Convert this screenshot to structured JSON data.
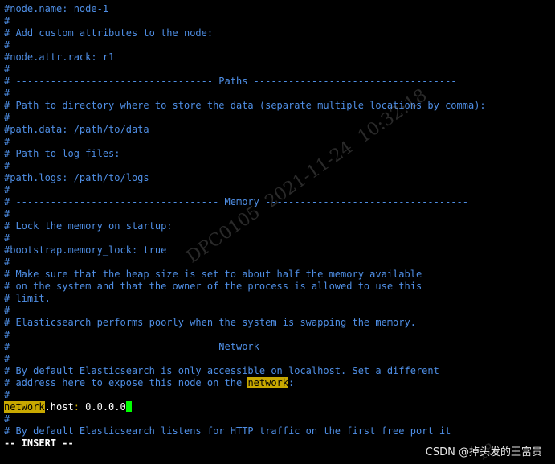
{
  "editor": {
    "lines": [
      {
        "type": "comment",
        "text": "#node.name: node-1"
      },
      {
        "type": "comment",
        "text": "#"
      },
      {
        "type": "comment",
        "text": "# Add custom attributes to the node:"
      },
      {
        "type": "comment",
        "text": "#"
      },
      {
        "type": "comment",
        "text": "#node.attr.rack: r1"
      },
      {
        "type": "comment",
        "text": "#"
      },
      {
        "type": "comment",
        "text": "# ---------------------------------- Paths -----------------------------------"
      },
      {
        "type": "comment",
        "text": "#"
      },
      {
        "type": "comment",
        "text": "# Path to directory where to store the data (separate multiple locations by comma):"
      },
      {
        "type": "comment",
        "text": "#"
      },
      {
        "type": "comment",
        "text": "#path.data: /path/to/data"
      },
      {
        "type": "comment",
        "text": "#"
      },
      {
        "type": "comment",
        "text": "# Path to log files:"
      },
      {
        "type": "comment",
        "text": "#"
      },
      {
        "type": "comment",
        "text": "#path.logs: /path/to/logs"
      },
      {
        "type": "comment",
        "text": "#"
      },
      {
        "type": "comment",
        "text": "# ----------------------------------- Memory -----------------------------------"
      },
      {
        "type": "comment",
        "text": "#"
      },
      {
        "type": "comment",
        "text": "# Lock the memory on startup:"
      },
      {
        "type": "comment",
        "text": "#"
      },
      {
        "type": "comment",
        "text": "#bootstrap.memory_lock: true"
      },
      {
        "type": "comment",
        "text": "#"
      },
      {
        "type": "comment",
        "text": "# Make sure that the heap size is set to about half the memory available"
      },
      {
        "type": "comment",
        "text": "# on the system and that the owner of the process is allowed to use this"
      },
      {
        "type": "comment",
        "text": "# limit."
      },
      {
        "type": "comment",
        "text": "#"
      },
      {
        "type": "comment",
        "text": "# Elasticsearch performs poorly when the system is swapping the memory."
      },
      {
        "type": "comment",
        "text": "#"
      },
      {
        "type": "comment",
        "text": "# ---------------------------------- Network -----------------------------------"
      },
      {
        "type": "comment",
        "text": "#"
      },
      {
        "type": "comment",
        "text": "# By default Elasticsearch is only accessible on localhost. Set a different"
      },
      {
        "type": "highlight_line",
        "before": "# address here to expose this node on the ",
        "match": "network",
        "after": ":"
      },
      {
        "type": "comment",
        "text": "#"
      },
      {
        "type": "setting",
        "match": "network",
        "rest": ".host",
        "colon": ":",
        "value": " 0.0.0.0"
      },
      {
        "type": "comment",
        "text": "#"
      },
      {
        "type": "comment",
        "text": "# By default Elasticsearch listens for HTTP traffic on the first free port it"
      }
    ],
    "mode": "-- INSERT --"
  },
  "watermarks": {
    "diagonal_1": "DPC0105  2021-11-24  10:32:18",
    "diagonal_2": "18",
    "credit": "CSDN @掉头发的王富贵"
  },
  "colors": {
    "background": "#000000",
    "comment": "#4f8fe6",
    "highlight": "#c8a800",
    "cursor": "#00ff00",
    "text": "#ffffff"
  }
}
